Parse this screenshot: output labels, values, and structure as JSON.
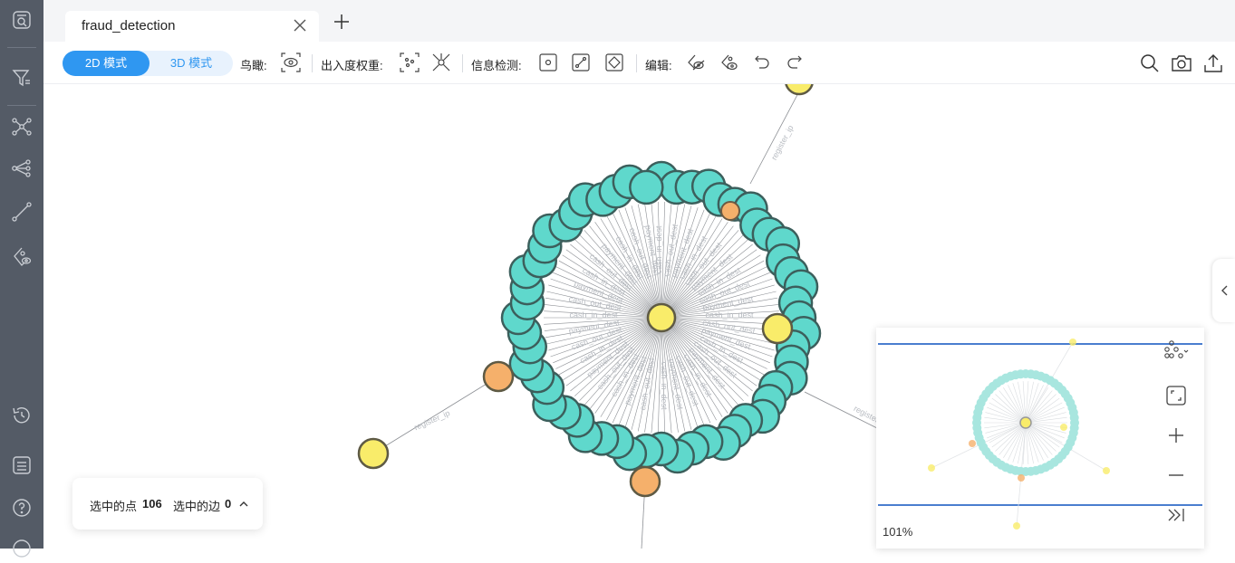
{
  "tab": {
    "title": "fraud_detection"
  },
  "toolbar": {
    "mode_2d": "2D 模式",
    "mode_3d": "3D 模式",
    "birdseye_label": "鸟瞰:",
    "degree_label": "出入度权重:",
    "info_label": "信息检测:",
    "edit_label": "编辑:"
  },
  "selection": {
    "nodes_label": "选中的点",
    "nodes_count": "106",
    "edges_label": "选中的边",
    "edges_count": "0"
  },
  "minimap": {
    "zoom": "101%"
  },
  "graph": {
    "edge_label_register": "register_ip",
    "edge_label_cash_in": "cash_in_dest",
    "edge_label_cash_out": "cash_out_dest",
    "edge_label_pay": "payment_dest",
    "colors": {
      "teal": "#5fd8cc",
      "yellow": "#f9ec6a",
      "orange": "#f5b06b",
      "accent": "#2f97f1",
      "sidebar": "#545b66"
    }
  },
  "icons": {
    "sidebar": [
      "search-panel-icon",
      "filter-icon",
      "network-icon",
      "share-icon",
      "path-icon",
      "tag-eye-icon",
      "history-icon",
      "list-icon",
      "help-icon"
    ],
    "toolbar_right": [
      "search-icon",
      "camera-icon",
      "upload-icon"
    ]
  }
}
